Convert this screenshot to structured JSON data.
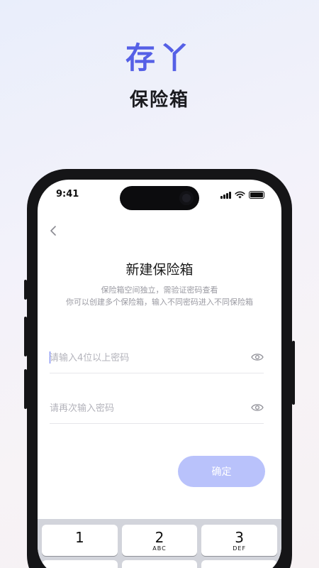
{
  "promo": {
    "brand": "存丫",
    "subtitle": "保险箱"
  },
  "status_bar": {
    "time": "9:41"
  },
  "page": {
    "title": "新建保险箱",
    "description_line1": "保险箱空间独立，需验证密码查看",
    "description_line2": "你可以创建多个保险箱，输入不同密码进入不同保险箱"
  },
  "form": {
    "password_placeholder": "请输入4位以上密码",
    "confirm_placeholder": "请再次输入密码",
    "confirm_button": "确定"
  },
  "keyboard": {
    "keys": [
      {
        "digit": "1",
        "letters": ""
      },
      {
        "digit": "2",
        "letters": "ABC"
      },
      {
        "digit": "3",
        "letters": "DEF"
      },
      {
        "digit": "",
        "letters": ""
      },
      {
        "digit": "",
        "letters": ""
      },
      {
        "digit": "",
        "letters": ""
      }
    ]
  },
  "colors": {
    "brand": "#5560e6",
    "button": "#b9c2fb",
    "caret": "#5a6cf0"
  }
}
